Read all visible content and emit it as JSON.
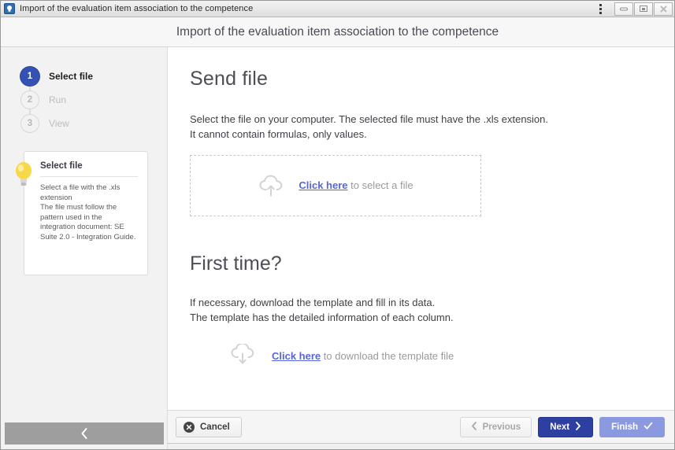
{
  "window": {
    "title": "Import of the evaluation item association to the competence",
    "app_icon": "lightbulb-app-icon",
    "menu_icon": "kebab-menu-icon",
    "controls": [
      {
        "name": "minimize",
        "icon": "minimize-icon"
      },
      {
        "name": "maximize",
        "icon": "maximize-icon"
      },
      {
        "name": "close",
        "icon": "close-icon"
      }
    ]
  },
  "header": {
    "title": "Import of the evaluation item association to the competence"
  },
  "wizard": {
    "steps": [
      {
        "number": "1",
        "label": "Select file",
        "state": "active"
      },
      {
        "number": "2",
        "label": "Run",
        "state": "inactive"
      },
      {
        "number": "3",
        "label": "View",
        "state": "inactive"
      }
    ]
  },
  "hint": {
    "icon": "lightbulb-icon",
    "title": "Select file",
    "text": "Select a file with the .xls extension\nThe file must follow the pattern used in the integration document: SE Suite 2.0 - Integration Guide."
  },
  "sidebar_footer": {
    "collapse_icon": "chevron-left-icon"
  },
  "main": {
    "send_file": {
      "title": "Send file",
      "description": "Select the file on your computer. The selected file must have the .xls extension.\nIt cannot contain formulas, only values.",
      "dropzone": {
        "icon": "cloud-upload-icon",
        "link_text": "Click here",
        "suffix_text": " to select a file"
      }
    },
    "first_time": {
      "title": "First time?",
      "description": "If necessary, download the template and fill in its data.\nThe template has the detailed information of each column.",
      "download": {
        "icon": "cloud-download-icon",
        "link_text": "Click here",
        "suffix_text": " to download the template file"
      }
    }
  },
  "footer": {
    "cancel": {
      "label": "Cancel",
      "icon": "cancel-circle-icon"
    },
    "previous": {
      "label": "Previous",
      "icon": "chevron-left-icon"
    },
    "next": {
      "label": "Next",
      "icon": "chevron-right-icon"
    },
    "finish": {
      "label": "Finish",
      "icon": "check-icon"
    }
  },
  "colors": {
    "accent_blue": "#2d3fa0",
    "step_active": "#3352b3",
    "finish_blue": "#8b9ae0",
    "link_blue": "#5566d8",
    "panel_bg": "#f2f2f2",
    "bulb_yellow": "#f4cf3a"
  }
}
